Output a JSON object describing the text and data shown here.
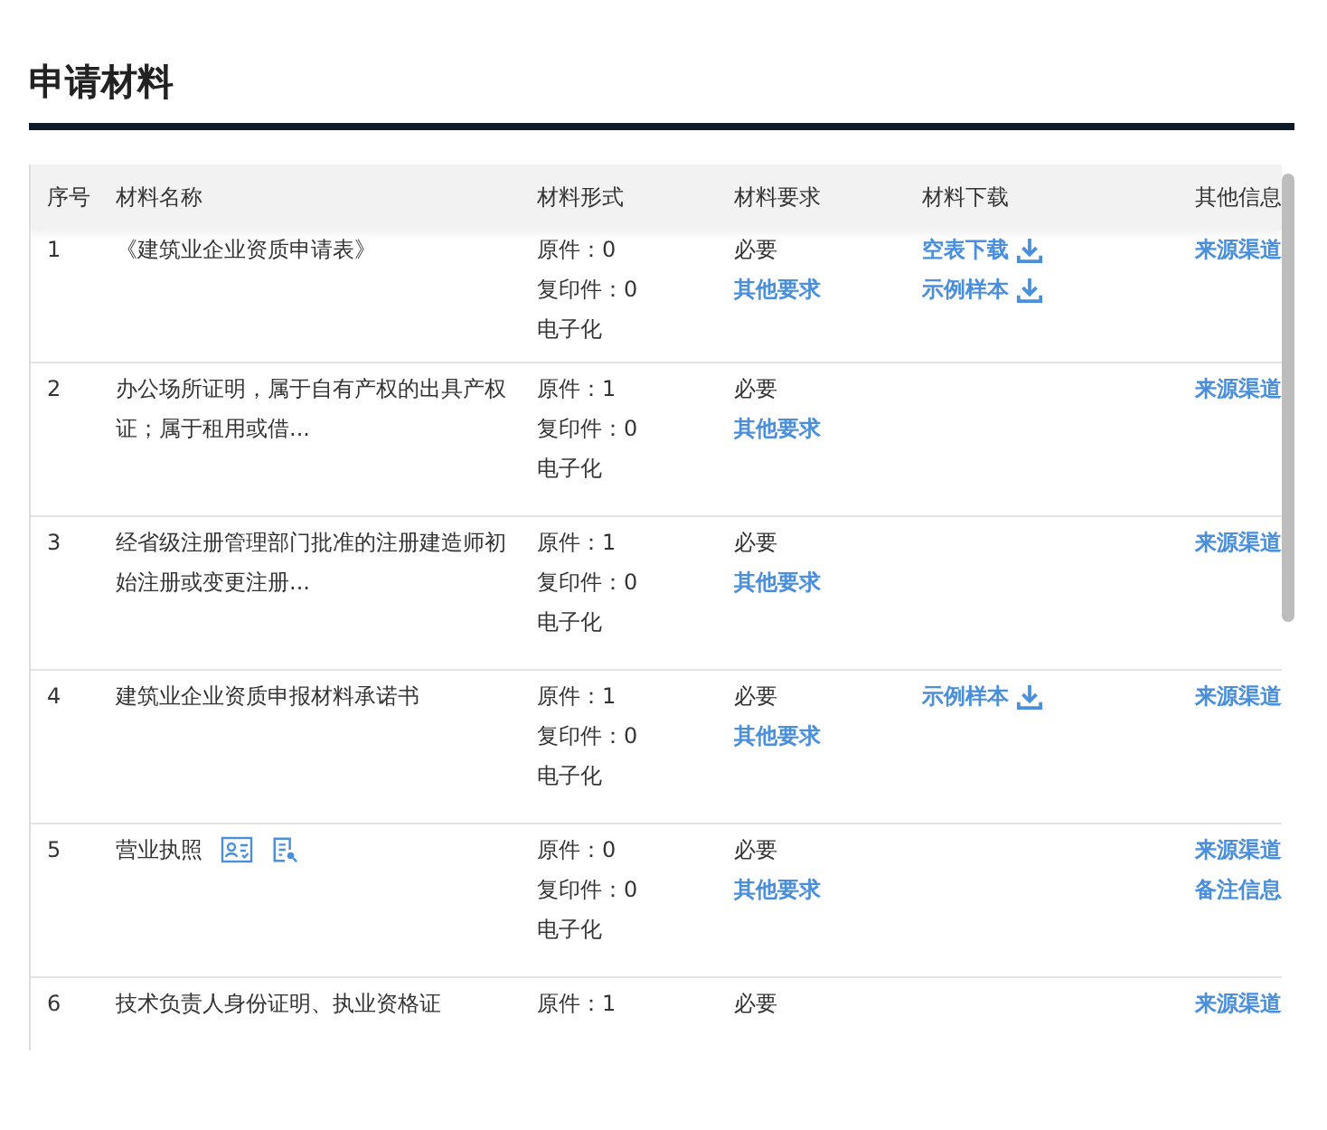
{
  "title": "申请材料",
  "table": {
    "columns": [
      "序号",
      "材料名称",
      "材料形式",
      "材料要求",
      "材料下载",
      "其他信息"
    ],
    "rows": [
      {
        "index": "1",
        "name": "《建筑业企业资质申请表》",
        "forms": [
          "原件：0",
          "复印件：0",
          "电子化"
        ],
        "requirement": "必要",
        "requirement_link": "其他要求",
        "downloads": [
          "空表下载",
          "示例样本"
        ],
        "other_info": [
          "来源渠道"
        ]
      },
      {
        "index": "2",
        "name": "办公场所证明，属于自有产权的出具产权证；属于租用或借...",
        "forms": [
          "原件：1",
          "复印件：0",
          "电子化"
        ],
        "requirement": "必要",
        "requirement_link": "其他要求",
        "other_info": [
          "来源渠道"
        ]
      },
      {
        "index": "3",
        "name": "经省级注册管理部门批准的注册建造师初始注册或变更注册...",
        "forms": [
          "原件：1",
          "复印件：0",
          "电子化"
        ],
        "requirement": "必要",
        "requirement_link": "其他要求",
        "other_info": [
          "来源渠道"
        ]
      },
      {
        "index": "4",
        "name": "建筑业企业资质申报材料承诺书",
        "forms": [
          "原件：1",
          "复印件：0",
          "电子化"
        ],
        "requirement": "必要",
        "requirement_link": "其他要求",
        "downloads": [
          "示例样本"
        ],
        "other_info": [
          "来源渠道"
        ]
      },
      {
        "index": "5",
        "name": "营业执照",
        "icons": [
          {
            "kind": "id-card"
          },
          {
            "kind": "document"
          }
        ],
        "forms": [
          "原件：0",
          "复印件：0",
          "电子化"
        ],
        "requirement": "必要",
        "requirement_link": "其他要求",
        "other_info": [
          "来源渠道",
          "备注信息"
        ]
      },
      {
        "index": "6",
        "name": "技术负责人身份证明、执业资格证",
        "forms": [
          "原件：1"
        ],
        "requirement": "必要",
        "other_info": [
          "来源渠道"
        ]
      }
    ]
  }
}
